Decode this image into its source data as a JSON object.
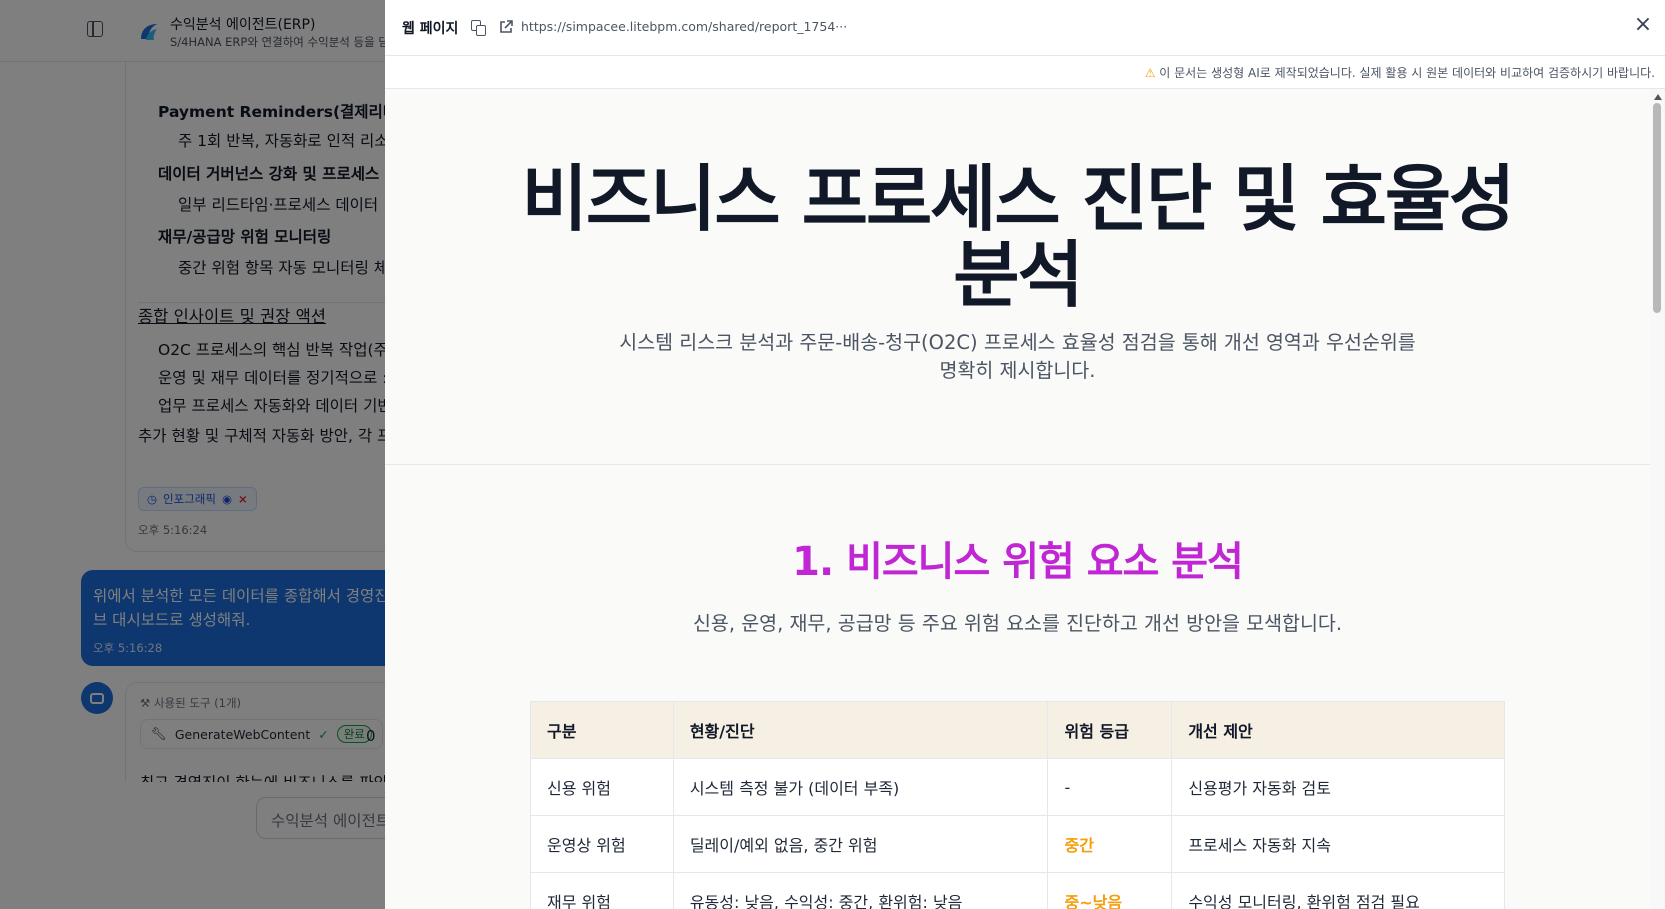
{
  "app": {
    "title": "수익분석 에이전트(ERP)",
    "subtitle": "S/4HANA ERP와 연결하여 수익분석 등을 담"
  },
  "chat": {
    "previous_message": {
      "lines": [
        {
          "text": "Payment Reminders(결제리마인",
          "style": "bold",
          "indent": 1
        },
        {
          "text": "주 1회 반복, 자동화로 인적 리소",
          "style": "normal",
          "indent": 2
        },
        {
          "text": "데이터 거버넌스 강화 및 프로세스 :",
          "style": "bold",
          "indent": 1
        },
        {
          "text": "일부 리드타임·프로세스 데이터",
          "style": "normal",
          "indent": 2
        },
        {
          "text": "재무/공급망 위험 모니터링",
          "style": "bold",
          "indent": 1
        },
        {
          "text": "중간 위험 항목 자동 모니터링 체",
          "style": "normal",
          "indent": 2
        },
        {
          "text": "종합 인사이트 및 권장 액션",
          "style": "heading",
          "indent": 0
        },
        {
          "text": "O2C 프로세스의 핵심 반복 작업(주",
          "style": "normal",
          "indent": 1
        },
        {
          "text": "운영 및 재무 데이터를 정기적으로 :",
          "style": "normal",
          "indent": 1
        },
        {
          "text": "업무 프로세스 자동화와 데이터 기반",
          "style": "normal",
          "indent": 1
        },
        {
          "text": "추가 현황 및 구체적 자동화 방안, 각 프",
          "style": "normal",
          "indent": 0
        }
      ],
      "attachment_label": "인포그래픽",
      "timestamp": "오후 5:16:24"
    },
    "user_message": {
      "text": "위에서 분석한 모든 데이터를 종합해서 경영진 브 대시보드로 생성해줘.",
      "timestamp": "오후 5:16:28"
    },
    "assistant_message": {
      "tools_label": "사용된 도구 (1개)",
      "tool_name": "GenerateWebContent",
      "tool_status": "완료",
      "tool_extra": "0",
      "truncated_text": "최고 경영진이 한눈에 비즈니스를 파악"
    },
    "input_placeholder": "수익분석 에이전트"
  },
  "modal": {
    "title": "웹 페이지",
    "url": "https://simpacee.litebpm.com/shared/report_1754···",
    "close_label": "×",
    "notice": "이 문서는 생성형 AI로 제작되었습니다. 실제 활용 시 원본 데이터와 비교하여 검증하시기 바랍니다.",
    "notice_icon": "⚠"
  },
  "report": {
    "title": "비즈니스 프로세스 진단 및 효율성 분석",
    "subtitle": "시스템 리스크 분석과 주문-배송-청구(O2C) 프로세스 효율성 점검을 통해 개선 영역과 우선순위를 명확히 제시합니다.",
    "section1": {
      "title": "1. 비즈니스 위험 요소 분석",
      "description": "신용, 운영, 재무, 공급망 등 주요 위험 요소를 진단하고 개선 방안을 모색합니다.",
      "table": {
        "headers": [
          "구분",
          "현황/진단",
          "위험 등급",
          "개선 제안"
        ],
        "rows": [
          {
            "category": "신용 위험",
            "status": "시스템 측정 불가 (데이터 부족)",
            "level": "-",
            "suggestion": "신용평가 자동화 검토"
          },
          {
            "category": "운영상 위험",
            "status": "딜레이/예외 없음, 중간 위험",
            "level": "중간",
            "suggestion": "프로세스 자동화 지속"
          },
          {
            "category": "재무 위험",
            "status": "유동성: 낮음, 수익성: 중간, 환위험: 낮음",
            "level": "중~낮음",
            "suggestion": "수익성 모니터링, 환위험 점검 필요"
          }
        ]
      }
    }
  },
  "colors": {
    "accent": "#1d6fe0",
    "section_title": "#c026d3",
    "risk_mid": "#f59e0b",
    "table_header_bg": "#f5efe4"
  }
}
